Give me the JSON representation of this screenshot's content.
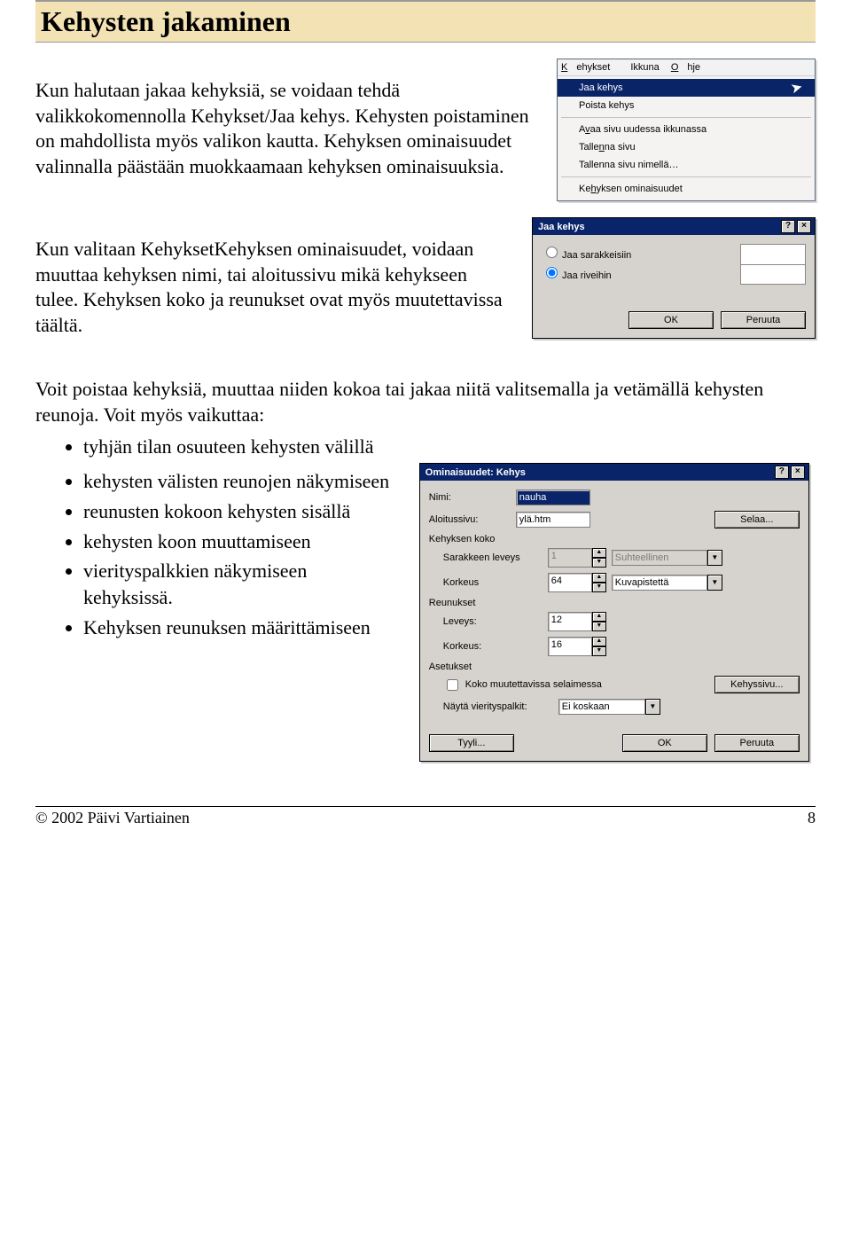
{
  "title": "Kehysten jakaminen",
  "para1": "Kun halutaan jakaa kehyksiä, se voidaan tehdä valikkokomennolla Kehykset/Jaa kehys. Kehysten poistaminen on mahdollista myös valikon kautta. Kehyksen ominaisuudet valinnalla päästään muokkaamaan kehyksen ominaisuuksia.",
  "para2": "Kun valitaan KehyksetKehyksen ominaisuudet, voidaan muuttaa kehyksen nimi, tai aloitussivu mikä kehykseen tulee. Kehyksen koko ja reunukset ovat myös muutettavissa täältä.",
  "para3": "Voit poistaa kehyksiä, muuttaa niiden kokoa tai jakaa niitä valitsemalla ja vetämällä kehysten reunoja. Voit myös vaikuttaa:",
  "bullets": [
    "tyhjän tilan osuuteen kehysten välillä",
    "kehysten välisten reunojen näkymiseen",
    "reunusten kokoon kehysten sisällä",
    "kehysten koon muuttamiseen",
    "vierityspalkkien näkymiseen kehyksissä.",
    "Kehyksen reunuksen määrittämiseen"
  ],
  "menu": {
    "tabs": {
      "kehykset": "Kehykset",
      "ikkuna": "Ikkuna",
      "ohje": "Ohje"
    },
    "items": {
      "jaa": "Jaa kehys",
      "poista": "Poista kehys",
      "avaa": "Avaa sivu uudessa ikkunassa",
      "tallenna": "Tallenna sivu",
      "tallenna_nimella": "Tallenna sivu nimellä…",
      "ominaisuudet": "Kehyksen ominaisuudet"
    }
  },
  "dlg1": {
    "title": "Jaa kehys",
    "help": "?",
    "close": "×",
    "radio1": "Jaa sarakkeisiin",
    "radio2": "Jaa riveihin",
    "ok": "OK",
    "cancel": "Peruuta"
  },
  "dlg2": {
    "title": "Ominaisuudet: Kehys",
    "help": "?",
    "close": "×",
    "labels": {
      "nimi": "Nimi:",
      "aloitussivu": "Aloitussivu:",
      "kehyksen_koko": "Kehyksen koko",
      "sarake_leveys": "Sarakkeen leveys",
      "korkeus": "Korkeus",
      "reunukset": "Reunukset",
      "leveys": "Leveys:",
      "korkeus2": "Korkeus:",
      "asetukset": "Asetukset",
      "koko_muutettavissa": "Koko muutettavissa selaimessa",
      "nayta_vierityspalkit": "Näytä vierityspalkit:"
    },
    "values": {
      "nimi": "nauha",
      "aloitussivu": "ylä.htm",
      "sarake_leveys": "1",
      "sarake_unit": "Suhteellinen",
      "korkeus": "64",
      "korkeus_unit": "Kuvapistettä",
      "reunus_leveys": "12",
      "reunus_korkeus": "16",
      "vierityspalkit": "Ei koskaan"
    },
    "buttons": {
      "selaa": "Selaa...",
      "kehyssivu": "Kehyssivu...",
      "tyyli": "Tyyli...",
      "ok": "OK",
      "cancel": "Peruuta"
    }
  },
  "footer": {
    "copyright": "© 2002 Päivi Vartiainen",
    "page": "8"
  }
}
